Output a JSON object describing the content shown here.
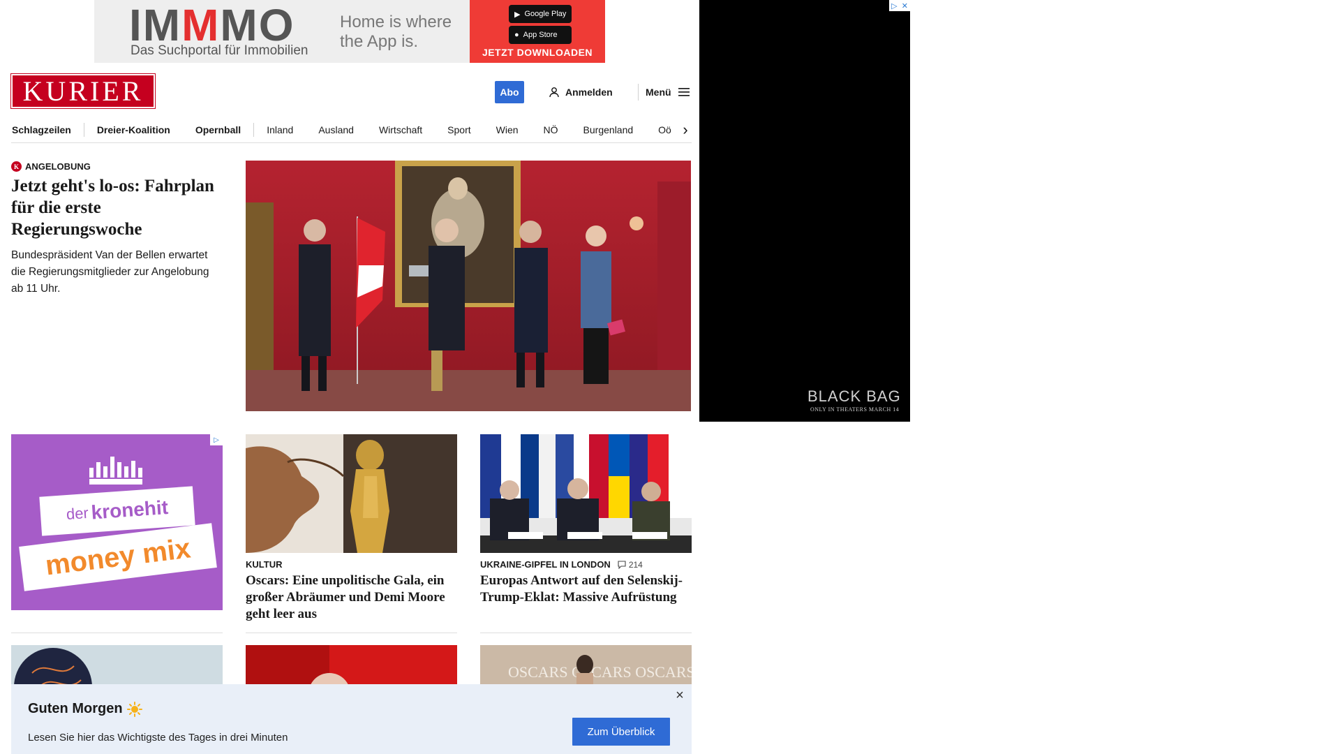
{
  "top_ad": {
    "brand_part1": "IM",
    "brand_part2": "M",
    "brand_part3": "MO",
    "tagline": "Das Suchportal für Immobilien",
    "slogan": "Home is where the App is.",
    "google_play": "Google Play",
    "app_store": "App Store",
    "cta": "JETZT DOWNLOADEN"
  },
  "side_ad": {
    "title": "BLACK BAG",
    "subtitle": "ONLY IN THEATERS MARCH 14"
  },
  "header": {
    "logo": "KURIER",
    "abo": "Abo",
    "login": "Anmelden",
    "menu": "Menü"
  },
  "nav": {
    "items": [
      "Schlagzeilen",
      "Dreier-Koalition",
      "Opernball",
      "Inland",
      "Ausland",
      "Wirtschaft",
      "Sport",
      "Wien",
      "NÖ",
      "Burgenland",
      "Oö"
    ]
  },
  "lead": {
    "kicker": "Angelobung",
    "title": "Jetzt geht's lo-os: Fahrplan für die erste Regierungswoche",
    "teaser": "Bundespräsident Van der Bellen erwartet die Regierungsmitglieder zur Angelobung ab 11 Uhr."
  },
  "radio_ad": {
    "der": "der",
    "kronehit": "kronehit",
    "money_mix": "money mix"
  },
  "cards": [
    {
      "kicker": "Kultur",
      "title": "Oscars: Eine unpolitische Gala, ein großer Abräumer und Demi Moore geht leer aus"
    },
    {
      "kicker": "Ukraine-Gipfel in London",
      "comments": "214",
      "title": "Europas Antwort auf den Selenskij-Trump-Eklat: Massive Aufrüstung"
    }
  ],
  "row3": {
    "oscars_text": "OSCARS OSCARS OSCARS"
  },
  "toast": {
    "title": "Guten Morgen",
    "text": "Lesen Sie hier das Wichtigste des Tages in drei Minuten",
    "button": "Zum Überblick"
  },
  "colors": {
    "brand_red": "#c5001f",
    "accent_blue": "#2f6bd5",
    "toast_bg": "#e9eff8",
    "radio_purple": "#a65cc8"
  }
}
